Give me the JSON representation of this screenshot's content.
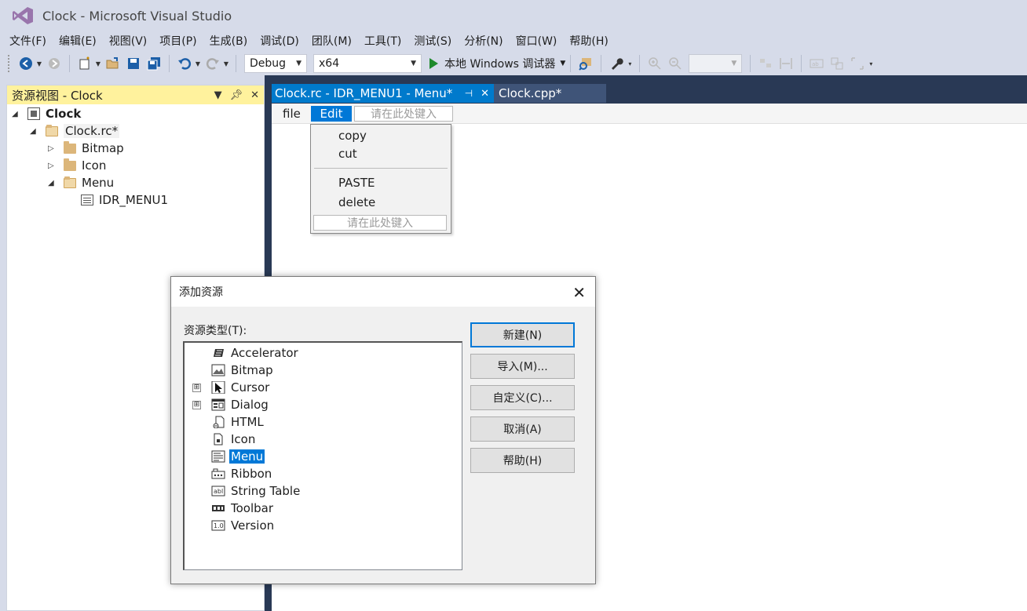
{
  "window": {
    "title": "Clock - Microsoft Visual Studio"
  },
  "menubar": [
    "文件(F)",
    "编辑(E)",
    "视图(V)",
    "项目(P)",
    "生成(B)",
    "调试(D)",
    "团队(M)",
    "工具(T)",
    "测试(S)",
    "分析(N)",
    "窗口(W)",
    "帮助(H)"
  ],
  "toolbar": {
    "config": "Debug",
    "platform": "x64",
    "run_label": "本地 Windows 调试器"
  },
  "resource_view": {
    "title": "资源视图 - Clock",
    "tree": {
      "project": "Clock",
      "rc_file": "Clock.rc*",
      "folders": [
        "Bitmap",
        "Icon",
        "Menu"
      ],
      "menu_item": "IDR_MENU1"
    }
  },
  "tabs": [
    {
      "label": "Clock.rc - IDR_MENU1 - Menu*",
      "active": true
    },
    {
      "label": "Clock.cpp*",
      "active": false
    }
  ],
  "menu_editor": {
    "items": [
      "file",
      "Edit"
    ],
    "type_here": "请在此处键入",
    "edit_dropdown": [
      "copy",
      "cut",
      "PASTE",
      "delete"
    ]
  },
  "dialog": {
    "title": "添加资源",
    "label": "资源类型(T):",
    "resource_types": [
      {
        "name": "Accelerator",
        "icon": "accelerator-icon",
        "expandable": false
      },
      {
        "name": "Bitmap",
        "icon": "bitmap-icon",
        "expandable": false
      },
      {
        "name": "Cursor",
        "icon": "cursor-icon",
        "expandable": true
      },
      {
        "name": "Dialog",
        "icon": "dialog-icon",
        "expandable": true
      },
      {
        "name": "HTML",
        "icon": "html-icon",
        "expandable": false
      },
      {
        "name": "Icon",
        "icon": "icon-resource-icon",
        "expandable": false
      },
      {
        "name": "Menu",
        "icon": "menu-resource-icon",
        "expandable": false,
        "selected": true
      },
      {
        "name": "Ribbon",
        "icon": "ribbon-icon",
        "expandable": false
      },
      {
        "name": "String Table",
        "icon": "string-table-icon",
        "expandable": false
      },
      {
        "name": "Toolbar",
        "icon": "toolbar-resource-icon",
        "expandable": false
      },
      {
        "name": "Version",
        "icon": "version-icon",
        "expandable": false
      }
    ],
    "buttons": {
      "new": "新建(N)",
      "import": "导入(M)...",
      "custom": "自定义(C)...",
      "cancel": "取消(A)",
      "help": "帮助(H)"
    }
  },
  "colors": {
    "accent": "#007acc",
    "panel_header": "#fff29d",
    "dark_frame": "#293955",
    "selection": "#0078d7"
  }
}
